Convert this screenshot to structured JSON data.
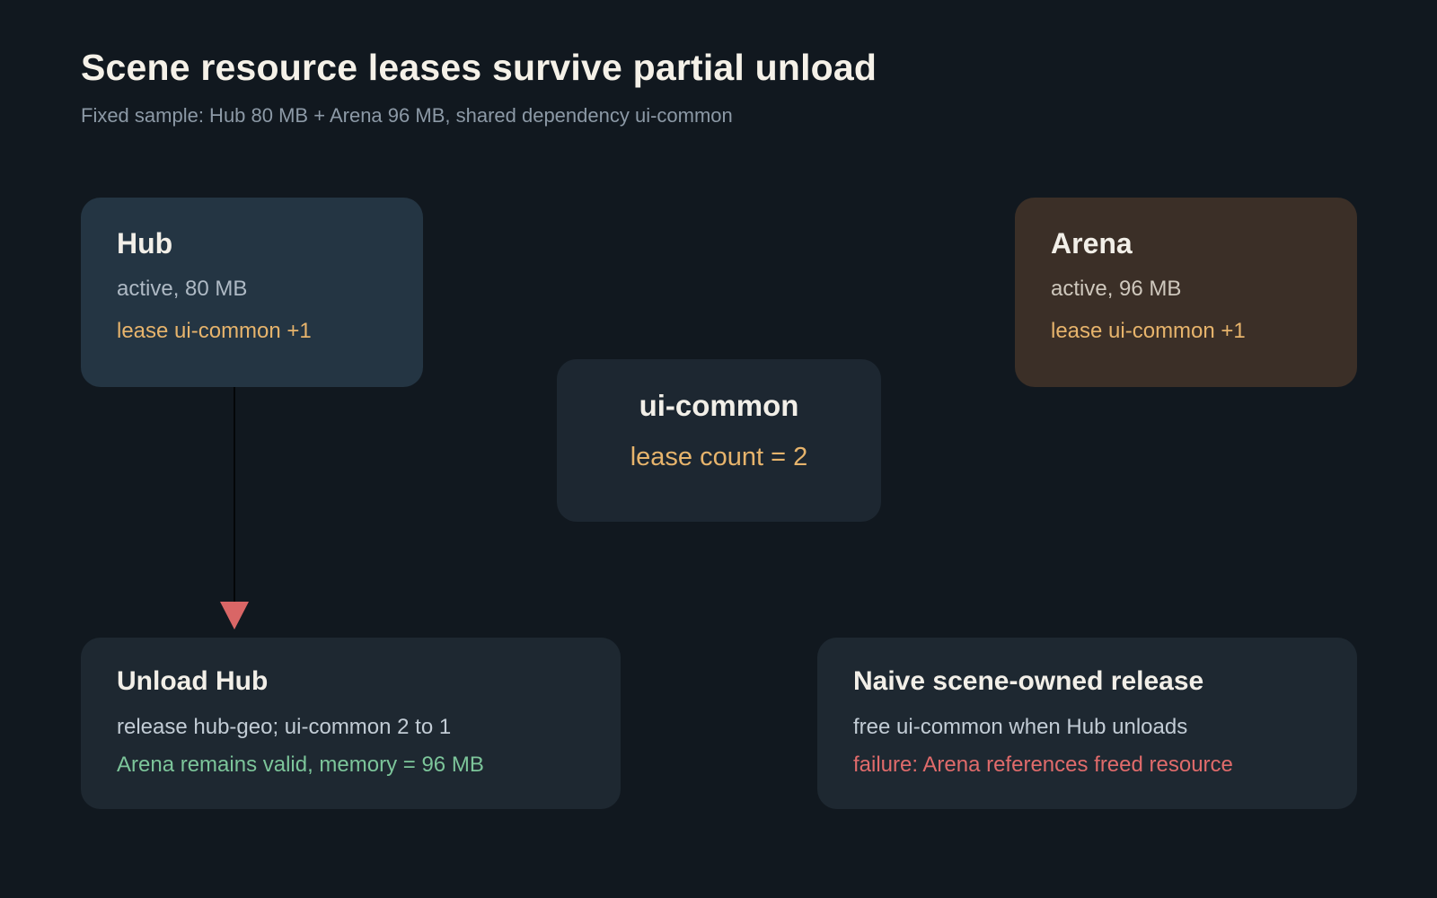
{
  "header": {
    "title": "Scene resource leases survive partial unload",
    "subtitle": "Fixed sample: Hub 80 MB + Arena 96 MB, shared dependency ui-common"
  },
  "nodes": {
    "hub": {
      "title": "Hub",
      "state": "active, 80 MB",
      "lease": "lease ui-common +1"
    },
    "arena": {
      "title": "Arena",
      "state": "active, 96 MB",
      "lease": "lease ui-common +1"
    },
    "common": {
      "title": "ui-common",
      "lease": "lease count = 2"
    },
    "unload": {
      "title": "Unload Hub",
      "detail": "release hub-geo; ui-common 2 to 1",
      "outcome": "Arena remains valid, memory = 96 MB"
    },
    "naive": {
      "title": "Naive scene-owned release",
      "detail": "free ui-common when Hub unloads",
      "outcome": "failure: Arena references freed resource"
    }
  },
  "colors": {
    "background": "#11181f",
    "hub_card": "#243543",
    "arena_card": "#3b2f27",
    "lease_text": "#e7b46c",
    "success_text": "#7cc59a",
    "failure_text": "#e06b6b",
    "arrow_head": "#d96666"
  }
}
